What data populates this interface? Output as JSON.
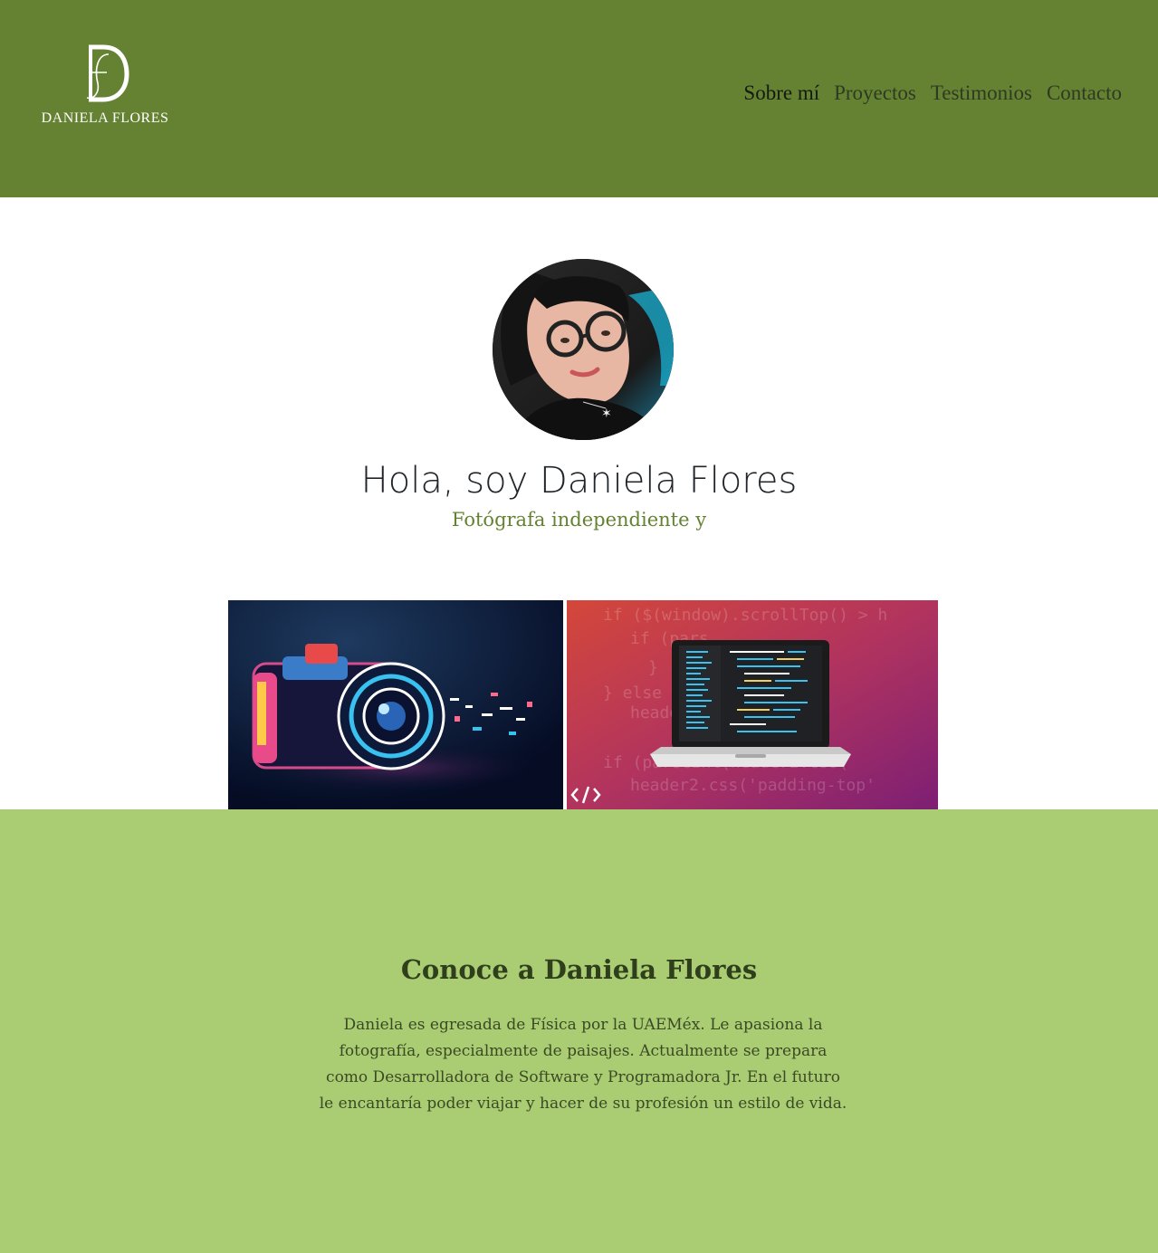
{
  "header": {
    "brand_name": "DANIELA FLORES",
    "nav": [
      {
        "label": "Sobre mí",
        "active": true
      },
      {
        "label": "Proyectos"
      },
      {
        "label": "Testimonios"
      },
      {
        "label": "Contacto"
      }
    ]
  },
  "hero": {
    "title": "Hola, soy Daniela Flores",
    "subtitle": "Fotógrafa independiente y"
  },
  "about": {
    "title": "Conoce a Daniela Flores",
    "text": "Daniela es egresada de Física por la UAEMéx. Le apasiona la fotografía, especialmente de paisajes. Actualmente se prepara como Desarrolladora de Software y Programadora Jr. En el futuro le encantaría poder viajar y hacer de su profesión un estilo de vida."
  },
  "colors": {
    "header_bg": "#648232",
    "accent": "#648232",
    "about_bg": "#aacc73"
  },
  "icons": [
    "brand-monogram-icon",
    "code-icon"
  ]
}
